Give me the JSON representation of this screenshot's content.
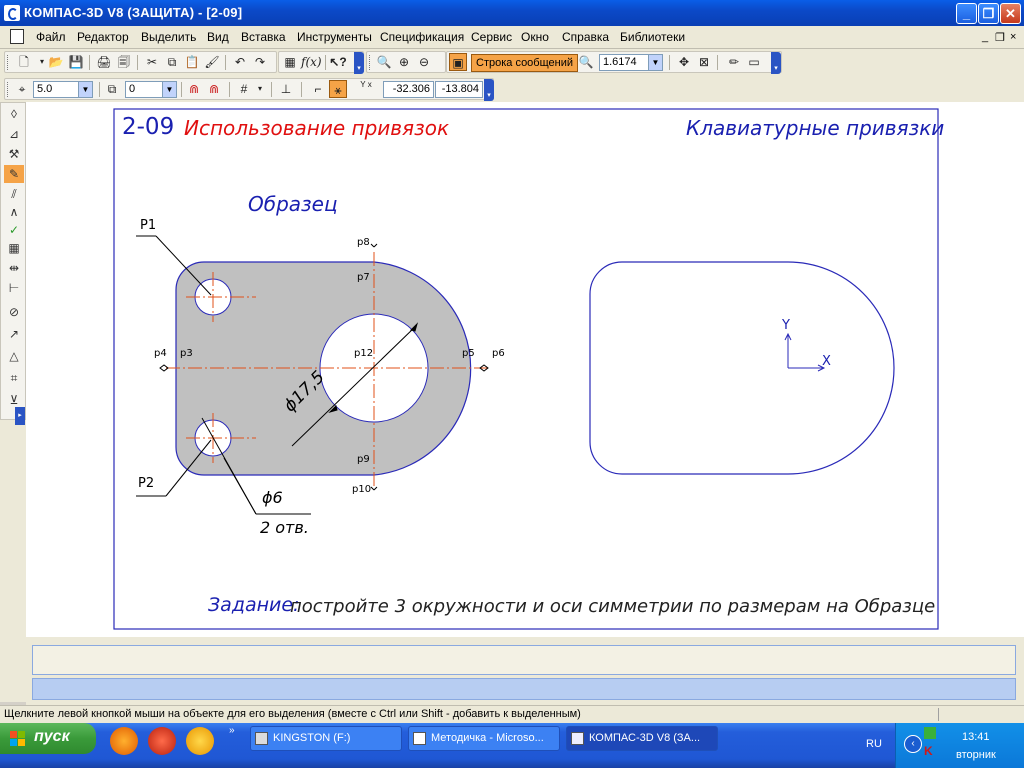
{
  "window": {
    "title": "КОМПАС-3D V8 (ЗАЩИТА) - [2-09]",
    "min": "_",
    "max": "❐",
    "close": "✕"
  },
  "menu": {
    "items": [
      "Файл",
      "Редактор",
      "Выделить",
      "Вид",
      "Вставка",
      "Инструменты",
      "Спецификация",
      "Сервис",
      "Окно",
      "Справка",
      "Библиотеки"
    ],
    "mdi": [
      "_",
      "❐",
      "×"
    ]
  },
  "toolbar1": {
    "message_button": "Строка сообщений",
    "zoom_value": "1.6174"
  },
  "toolbar2": {
    "step_value": "5.0",
    "layer_value": "0",
    "coord_label": "Y x",
    "coord_x": "-32.306",
    "coord_y": "-13.804"
  },
  "sheet": {
    "title_number": "2-09",
    "title_text": "Использование привязок",
    "title_right": "Клавиатурные привязки",
    "sample_label": "Образец",
    "task_label": "Задание:",
    "task_text": "постройте 3 окружности и оси симметрии по размерам на Образце",
    "points": {
      "p1": "P1",
      "p2": "P2",
      "p3": "p3",
      "p4": "p4",
      "p5": "p5",
      "p6": "p6",
      "p7": "p7",
      "p8": "p8",
      "p9": "p9",
      "p10": "p10",
      "p12": "p12"
    },
    "dim_big": "ϕ17,5",
    "dim_small": "ϕ6",
    "dim_small_count": "2 отв.",
    "axis_y": "Y",
    "axis_x": "X"
  },
  "status": {
    "text": "Щелкните левой кнопкой мыши на объекте для его выделения (вместе с Ctrl или Shift - добавить к выделенным)"
  },
  "taskbar": {
    "start": "пуск",
    "tasks": [
      "KINGSTON (F:)",
      "Методичка - Microso...",
      "КОМПАС-3D V8 (ЗА..."
    ],
    "lang": "RU",
    "time": "13:41",
    "day": "вторник"
  },
  "colors": {
    "title_blue": "#1a20b0",
    "title_red": "#e01010",
    "part_fill": "#c0c0c0",
    "part_stroke": "#2a2ab8",
    "axis_orange": "#e0501a"
  }
}
